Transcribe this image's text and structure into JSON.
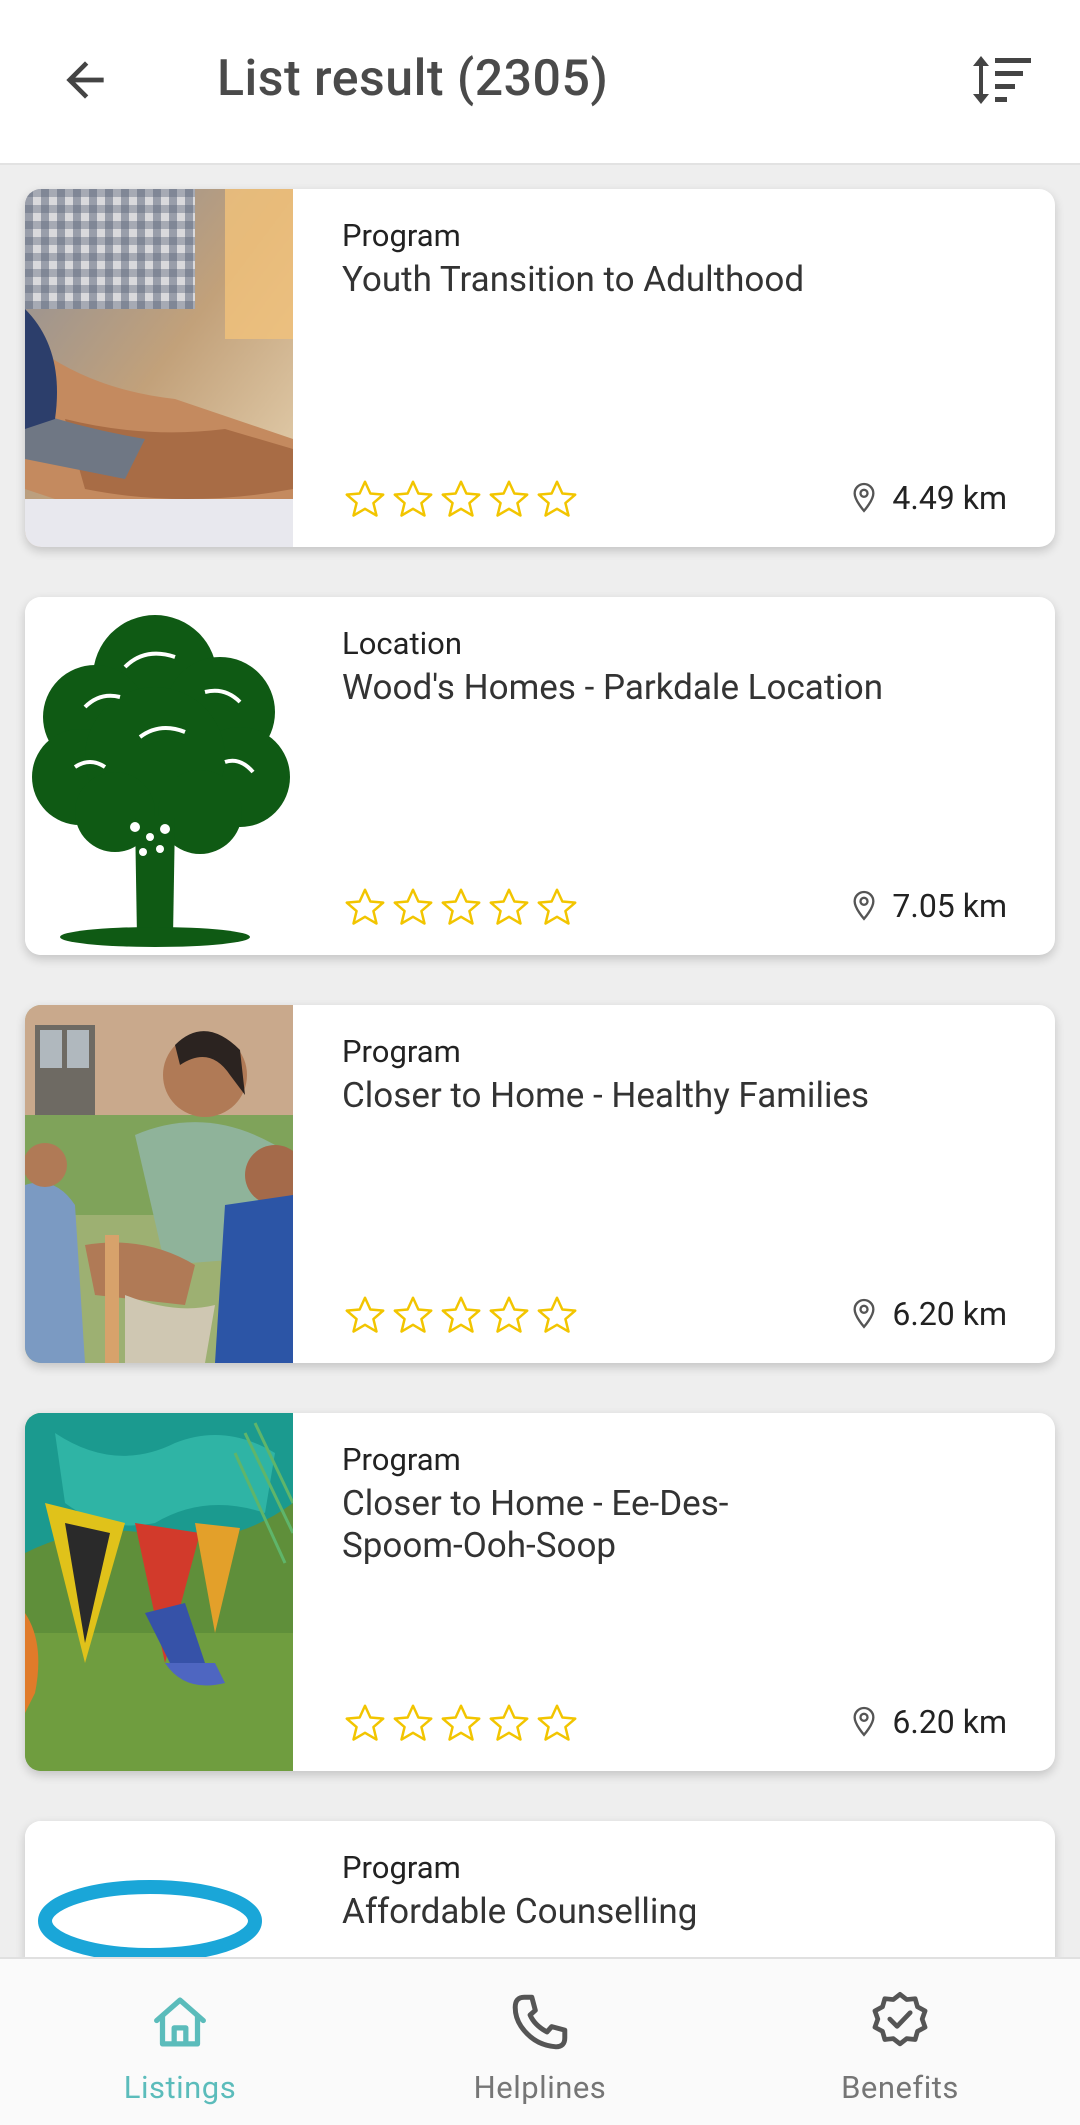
{
  "header": {
    "title": "List result (2305)",
    "back_icon": "arrow-left-icon",
    "sort_icon": "sort-icon"
  },
  "listings": [
    {
      "type": "Program",
      "title": "Youth Transition to Adulthood",
      "rating": 0,
      "distance": "4.49 km"
    },
    {
      "type": "Location",
      "title": "Wood's Homes - Parkdale Location",
      "rating": 0,
      "distance": "7.05 km"
    },
    {
      "type": "Program",
      "title": "Closer to Home - Healthy Families",
      "rating": 0,
      "distance": "6.20 km"
    },
    {
      "type": "Program",
      "title": "Closer to Home - Ee-Des-Spoom-Ooh-Soop",
      "rating": 0,
      "distance": "6.20 km"
    },
    {
      "type": "Program",
      "title": "Affordable Counselling"
    }
  ],
  "bottom_nav": {
    "items": [
      {
        "label": "Listings",
        "icon": "home-icon",
        "active": true
      },
      {
        "label": "Helplines",
        "icon": "phone-icon",
        "active": false
      },
      {
        "label": "Benefits",
        "icon": "badge-check-icon",
        "active": false
      }
    ]
  },
  "colors": {
    "accent": "#5bbcbb",
    "star": "#f2c500",
    "tree": "#0f5a14",
    "logo_blue": "#1aa6d8"
  }
}
